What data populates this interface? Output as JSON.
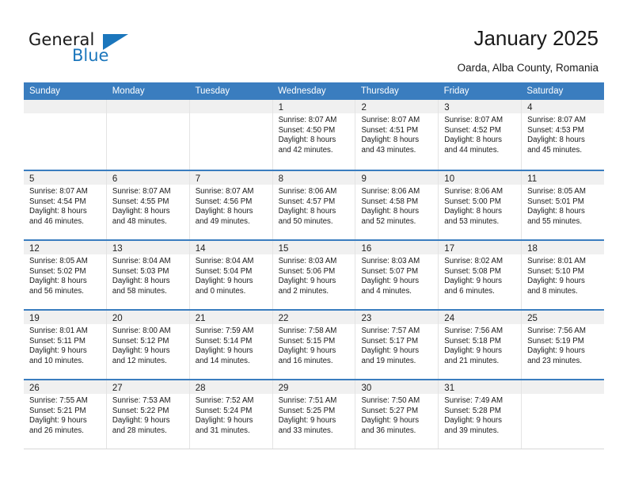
{
  "brand": {
    "name_part1": "General",
    "name_part2": "Blue",
    "triangle_color": "#1b76bc",
    "accent_color": "#3a7dbf"
  },
  "header": {
    "title": "January 2025",
    "subtitle": "Oarda, Alba County, Romania"
  },
  "calendar": {
    "weekdays": [
      "Sunday",
      "Monday",
      "Tuesday",
      "Wednesday",
      "Thursday",
      "Friday",
      "Saturday"
    ],
    "weeks": [
      [
        {
          "day": ""
        },
        {
          "day": ""
        },
        {
          "day": ""
        },
        {
          "day": "1",
          "sunrise": "Sunrise: 8:07 AM",
          "sunset": "Sunset: 4:50 PM",
          "daylight1": "Daylight: 8 hours",
          "daylight2": "and 42 minutes."
        },
        {
          "day": "2",
          "sunrise": "Sunrise: 8:07 AM",
          "sunset": "Sunset: 4:51 PM",
          "daylight1": "Daylight: 8 hours",
          "daylight2": "and 43 minutes."
        },
        {
          "day": "3",
          "sunrise": "Sunrise: 8:07 AM",
          "sunset": "Sunset: 4:52 PM",
          "daylight1": "Daylight: 8 hours",
          "daylight2": "and 44 minutes."
        },
        {
          "day": "4",
          "sunrise": "Sunrise: 8:07 AM",
          "sunset": "Sunset: 4:53 PM",
          "daylight1": "Daylight: 8 hours",
          "daylight2": "and 45 minutes."
        }
      ],
      [
        {
          "day": "5",
          "sunrise": "Sunrise: 8:07 AM",
          "sunset": "Sunset: 4:54 PM",
          "daylight1": "Daylight: 8 hours",
          "daylight2": "and 46 minutes."
        },
        {
          "day": "6",
          "sunrise": "Sunrise: 8:07 AM",
          "sunset": "Sunset: 4:55 PM",
          "daylight1": "Daylight: 8 hours",
          "daylight2": "and 48 minutes."
        },
        {
          "day": "7",
          "sunrise": "Sunrise: 8:07 AM",
          "sunset": "Sunset: 4:56 PM",
          "daylight1": "Daylight: 8 hours",
          "daylight2": "and 49 minutes."
        },
        {
          "day": "8",
          "sunrise": "Sunrise: 8:06 AM",
          "sunset": "Sunset: 4:57 PM",
          "daylight1": "Daylight: 8 hours",
          "daylight2": "and 50 minutes."
        },
        {
          "day": "9",
          "sunrise": "Sunrise: 8:06 AM",
          "sunset": "Sunset: 4:58 PM",
          "daylight1": "Daylight: 8 hours",
          "daylight2": "and 52 minutes."
        },
        {
          "day": "10",
          "sunrise": "Sunrise: 8:06 AM",
          "sunset": "Sunset: 5:00 PM",
          "daylight1": "Daylight: 8 hours",
          "daylight2": "and 53 minutes."
        },
        {
          "day": "11",
          "sunrise": "Sunrise: 8:05 AM",
          "sunset": "Sunset: 5:01 PM",
          "daylight1": "Daylight: 8 hours",
          "daylight2": "and 55 minutes."
        }
      ],
      [
        {
          "day": "12",
          "sunrise": "Sunrise: 8:05 AM",
          "sunset": "Sunset: 5:02 PM",
          "daylight1": "Daylight: 8 hours",
          "daylight2": "and 56 minutes."
        },
        {
          "day": "13",
          "sunrise": "Sunrise: 8:04 AM",
          "sunset": "Sunset: 5:03 PM",
          "daylight1": "Daylight: 8 hours",
          "daylight2": "and 58 minutes."
        },
        {
          "day": "14",
          "sunrise": "Sunrise: 8:04 AM",
          "sunset": "Sunset: 5:04 PM",
          "daylight1": "Daylight: 9 hours",
          "daylight2": "and 0 minutes."
        },
        {
          "day": "15",
          "sunrise": "Sunrise: 8:03 AM",
          "sunset": "Sunset: 5:06 PM",
          "daylight1": "Daylight: 9 hours",
          "daylight2": "and 2 minutes."
        },
        {
          "day": "16",
          "sunrise": "Sunrise: 8:03 AM",
          "sunset": "Sunset: 5:07 PM",
          "daylight1": "Daylight: 9 hours",
          "daylight2": "and 4 minutes."
        },
        {
          "day": "17",
          "sunrise": "Sunrise: 8:02 AM",
          "sunset": "Sunset: 5:08 PM",
          "daylight1": "Daylight: 9 hours",
          "daylight2": "and 6 minutes."
        },
        {
          "day": "18",
          "sunrise": "Sunrise: 8:01 AM",
          "sunset": "Sunset: 5:10 PM",
          "daylight1": "Daylight: 9 hours",
          "daylight2": "and 8 minutes."
        }
      ],
      [
        {
          "day": "19",
          "sunrise": "Sunrise: 8:01 AM",
          "sunset": "Sunset: 5:11 PM",
          "daylight1": "Daylight: 9 hours",
          "daylight2": "and 10 minutes."
        },
        {
          "day": "20",
          "sunrise": "Sunrise: 8:00 AM",
          "sunset": "Sunset: 5:12 PM",
          "daylight1": "Daylight: 9 hours",
          "daylight2": "and 12 minutes."
        },
        {
          "day": "21",
          "sunrise": "Sunrise: 7:59 AM",
          "sunset": "Sunset: 5:14 PM",
          "daylight1": "Daylight: 9 hours",
          "daylight2": "and 14 minutes."
        },
        {
          "day": "22",
          "sunrise": "Sunrise: 7:58 AM",
          "sunset": "Sunset: 5:15 PM",
          "daylight1": "Daylight: 9 hours",
          "daylight2": "and 16 minutes."
        },
        {
          "day": "23",
          "sunrise": "Sunrise: 7:57 AM",
          "sunset": "Sunset: 5:17 PM",
          "daylight1": "Daylight: 9 hours",
          "daylight2": "and 19 minutes."
        },
        {
          "day": "24",
          "sunrise": "Sunrise: 7:56 AM",
          "sunset": "Sunset: 5:18 PM",
          "daylight1": "Daylight: 9 hours",
          "daylight2": "and 21 minutes."
        },
        {
          "day": "25",
          "sunrise": "Sunrise: 7:56 AM",
          "sunset": "Sunset: 5:19 PM",
          "daylight1": "Daylight: 9 hours",
          "daylight2": "and 23 minutes."
        }
      ],
      [
        {
          "day": "26",
          "sunrise": "Sunrise: 7:55 AM",
          "sunset": "Sunset: 5:21 PM",
          "daylight1": "Daylight: 9 hours",
          "daylight2": "and 26 minutes."
        },
        {
          "day": "27",
          "sunrise": "Sunrise: 7:53 AM",
          "sunset": "Sunset: 5:22 PM",
          "daylight1": "Daylight: 9 hours",
          "daylight2": "and 28 minutes."
        },
        {
          "day": "28",
          "sunrise": "Sunrise: 7:52 AM",
          "sunset": "Sunset: 5:24 PM",
          "daylight1": "Daylight: 9 hours",
          "daylight2": "and 31 minutes."
        },
        {
          "day": "29",
          "sunrise": "Sunrise: 7:51 AM",
          "sunset": "Sunset: 5:25 PM",
          "daylight1": "Daylight: 9 hours",
          "daylight2": "and 33 minutes."
        },
        {
          "day": "30",
          "sunrise": "Sunrise: 7:50 AM",
          "sunset": "Sunset: 5:27 PM",
          "daylight1": "Daylight: 9 hours",
          "daylight2": "and 36 minutes."
        },
        {
          "day": "31",
          "sunrise": "Sunrise: 7:49 AM",
          "sunset": "Sunset: 5:28 PM",
          "daylight1": "Daylight: 9 hours",
          "daylight2": "and 39 minutes."
        },
        {
          "day": ""
        }
      ]
    ]
  }
}
